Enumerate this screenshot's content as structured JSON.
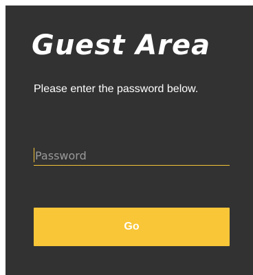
{
  "login": {
    "title": "Guest Area",
    "instructions": "Please enter the password below.",
    "password_placeholder": "Password",
    "password_value": "",
    "submit_label": "Go"
  },
  "colors": {
    "panel_background": "#323232",
    "accent": "#f8c637",
    "text": "#ffffff"
  }
}
